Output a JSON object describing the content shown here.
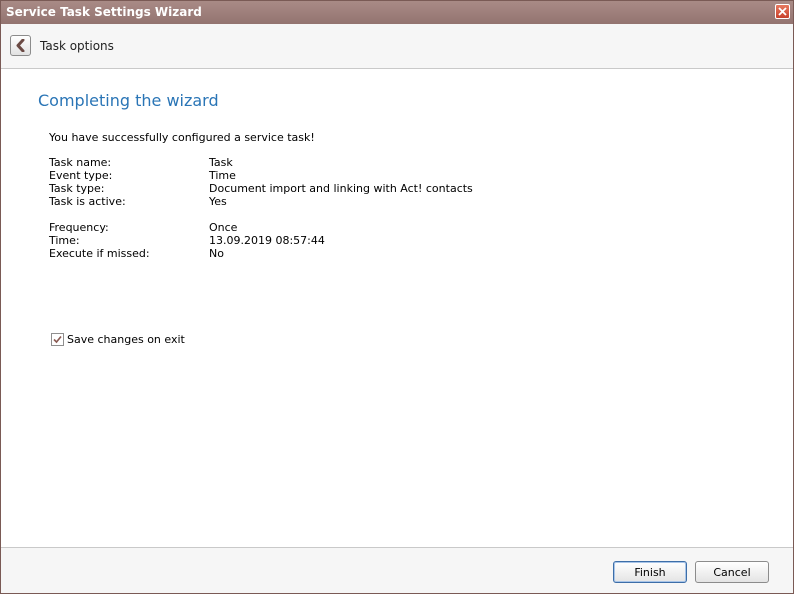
{
  "window": {
    "title": "Service Task Settings Wizard",
    "close_icon": "close-icon"
  },
  "header": {
    "back_icon": "chevron-left-icon",
    "title": "Task options"
  },
  "content": {
    "heading": "Completing the wizard",
    "success_message": "You have successfully configured a service task!",
    "summary_group1": [
      {
        "label": "Task name:",
        "value": "Task"
      },
      {
        "label": "Event type:",
        "value": "Time"
      },
      {
        "label": "Task type:",
        "value": "Document import and linking with Act! contacts"
      },
      {
        "label": "Task is active:",
        "value": "Yes"
      }
    ],
    "summary_group2": [
      {
        "label": "Frequency:",
        "value": "Once"
      },
      {
        "label": "Time:",
        "value": "13.09.2019 08:57:44"
      },
      {
        "label": "Execute if missed:",
        "value": "No"
      }
    ],
    "save_changes": {
      "label": "Save changes on exit",
      "checked": true
    }
  },
  "footer": {
    "finish_label": "Finish",
    "cancel_label": "Cancel"
  },
  "colors": {
    "titlebar": "#a0817c",
    "heading": "#2a75b6",
    "close_button": "#d9573f"
  }
}
